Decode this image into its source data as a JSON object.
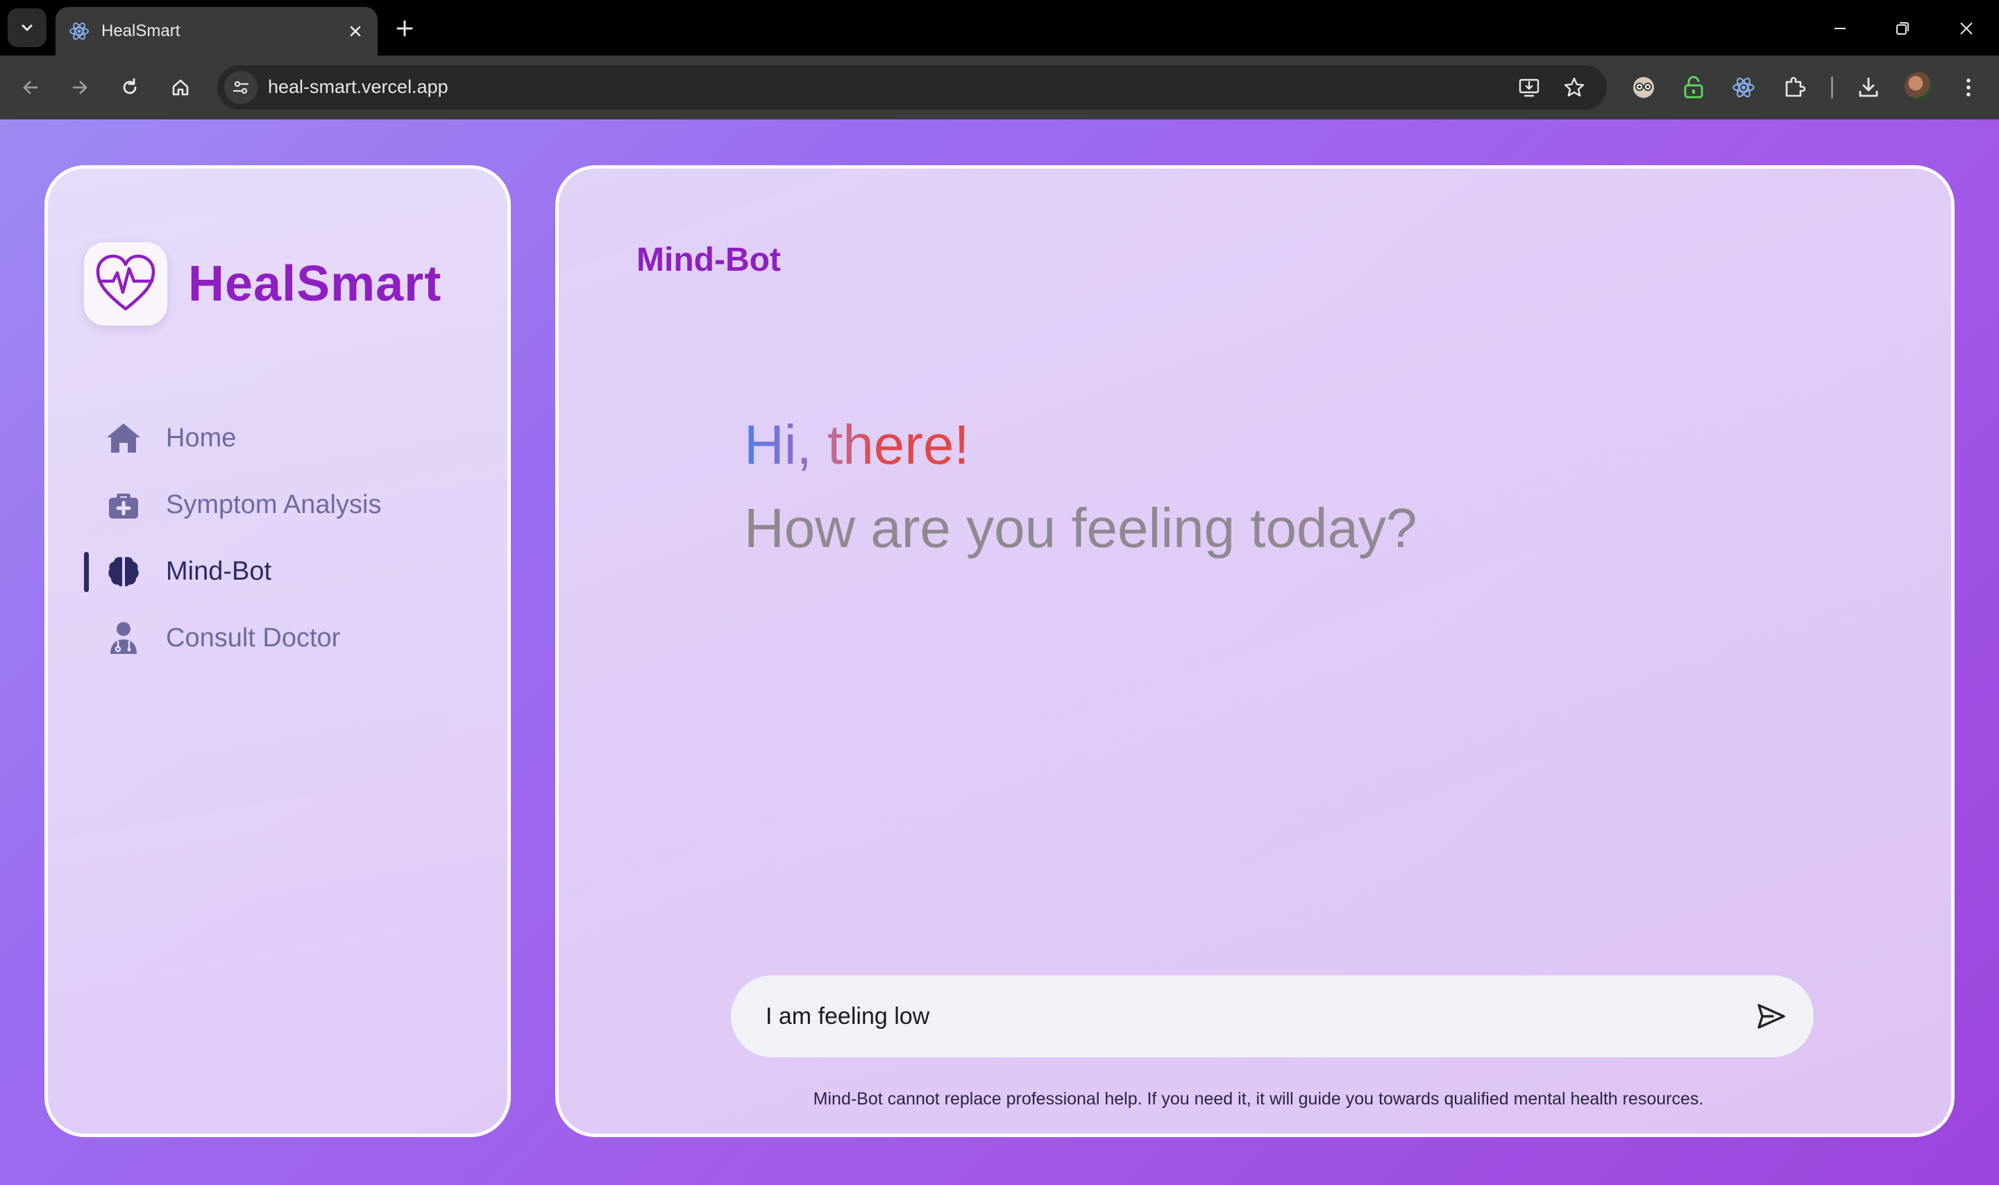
{
  "browser": {
    "tab_title": "HealSmart",
    "url": "heal-smart.vercel.app"
  },
  "app": {
    "brand_name": "HealSmart",
    "brand_color": "#8e1fc0",
    "nav": [
      {
        "label": "Home",
        "icon": "home-icon",
        "active": false
      },
      {
        "label": "Symptom Analysis",
        "icon": "medical-kit-icon",
        "active": false
      },
      {
        "label": "Mind-Bot",
        "icon": "brain-icon",
        "active": true
      },
      {
        "label": "Consult Doctor",
        "icon": "doctor-icon",
        "active": false
      }
    ]
  },
  "main": {
    "title": "Mind-Bot",
    "greeting": "Hi, there!",
    "prompt": "How are you feeling today?",
    "input_value": "I am feeling low",
    "send_icon": "send-icon",
    "disclaimer": "Mind-Bot cannot replace professional help. If you need it, it will guide you towards qualified mental health resources."
  }
}
